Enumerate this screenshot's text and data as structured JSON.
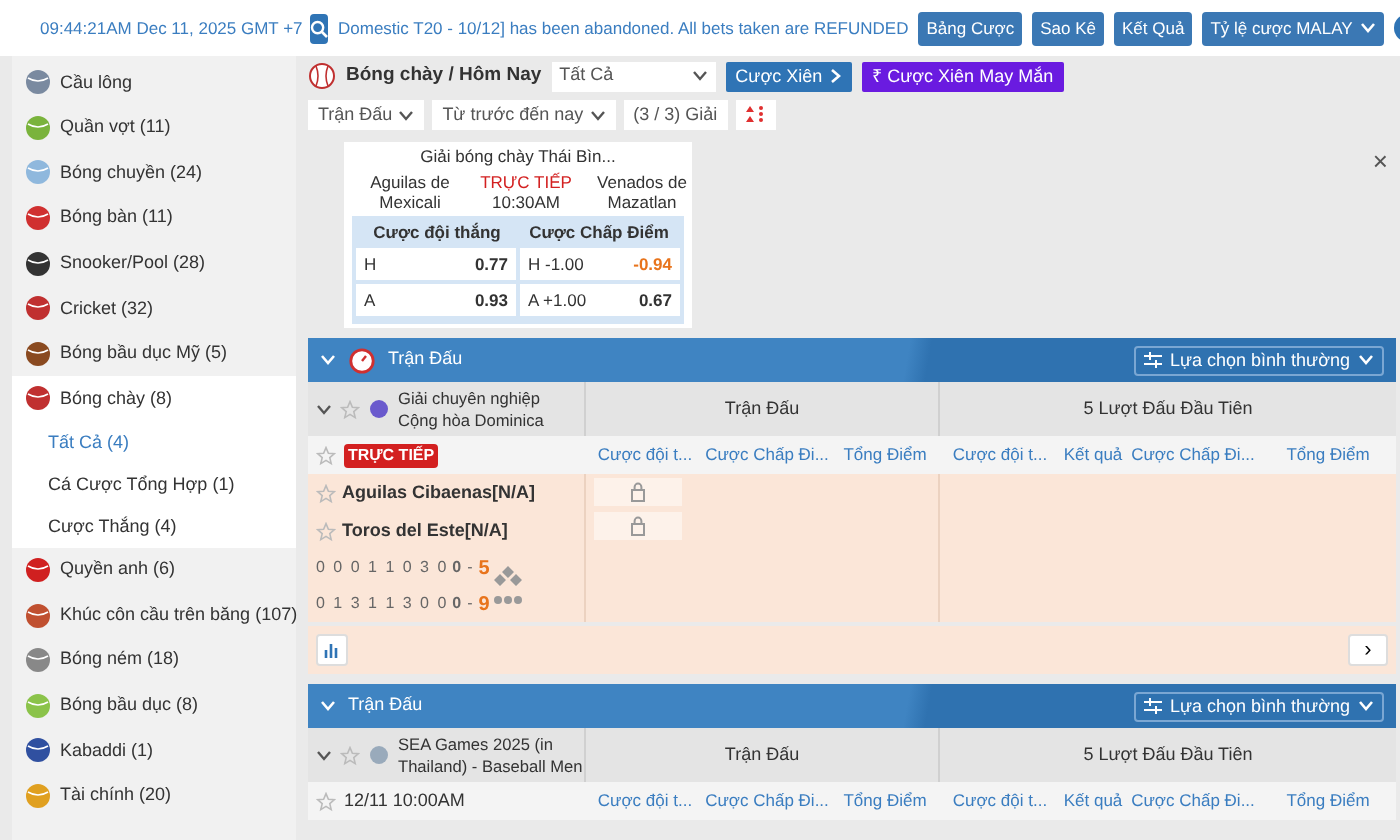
{
  "top_bar": {
    "clock": "09:44:21AM Dec 11, 2025 GMT +7",
    "announcement": "Domestic T20 - 10/12] has been abandoned. All bets taken are REFUNDED",
    "buttons": [
      "Bảng Cược",
      "Sao Kê",
      "Kết Quả"
    ],
    "odds_format": "Tỷ lệ cược MALAY",
    "toggle_on": true
  },
  "sidebar": {
    "items": [
      {
        "label": "Cầu lông",
        "selected": false
      },
      {
        "label": "Quần vợt (11)",
        "selected": false
      },
      {
        "label": "Bóng chuyền (24)",
        "selected": false
      },
      {
        "label": "Bóng bàn (11)",
        "selected": false
      },
      {
        "label": "Snooker/Pool (28)",
        "selected": false
      },
      {
        "label": "Cricket (32)",
        "selected": false
      },
      {
        "label": "Bóng bầu dục Mỹ (5)",
        "selected": false
      },
      {
        "label": "Bóng chày (8)",
        "selected": true,
        "children": [
          {
            "label": "Tất Cả (4)",
            "selected": true
          },
          {
            "label": "Cá Cược Tổng Hợp (1)",
            "selected": false
          },
          {
            "label": "Cược Thắng (4)",
            "selected": false
          }
        ]
      },
      {
        "label": "Quyền anh (6)",
        "selected": false
      },
      {
        "label": "Khúc côn cầu trên băng (107)",
        "selected": false
      },
      {
        "label": "Bóng ném (18)",
        "selected": false
      },
      {
        "label": "Bóng bầu dục (8)",
        "selected": false
      },
      {
        "label": "Kabaddi (1)",
        "selected": false
      },
      {
        "label": "Tài chính (20)",
        "selected": false
      }
    ]
  },
  "toolbar": {
    "breadcrumb": "Bóng chày / Hôm Nay",
    "market_select": "Tất Cả",
    "parlay_button": "Cược Xiên",
    "lucky_symbol": "₹",
    "lucky_button": "Cược Xiên May Mắn",
    "filter_type": "Trận Đấu",
    "filter_time": "Từ trước đến nay",
    "league_count": "(3 / 3) Giải"
  },
  "featured": {
    "league": "Giải bóng chày Thái Bìn...",
    "home": "Aguilas de Mexicali",
    "status": "TRỰC TIẾP",
    "time": "10:30AM",
    "away": "Venados de Mazatlan",
    "close": "×",
    "headers": [
      "Cược đội thắng",
      "Cược Chấp Điểm"
    ],
    "rows": [
      {
        "side": "H",
        "win": "0.77",
        "hcp_side": "H",
        "hcp": "-1.00",
        "hcp_odds": "-0.94",
        "negative": true
      },
      {
        "side": "A",
        "win": "0.93",
        "hcp_side": "A",
        "hcp": "+1.00",
        "hcp_odds": "0.67",
        "negative": false
      }
    ]
  },
  "sections": [
    {
      "title": "Trận Đấu",
      "clock_icon": true,
      "view": "Lựa chọn bình thường",
      "league": "Giải chuyên nghiệp Cộng hòa Dominica",
      "group_1": "Trận Đấu",
      "group_2": "5 Lượt Đấu Đầu Tiên",
      "status": "TRỰC TIẾP",
      "live": true,
      "columns": [
        "Cược đội t...",
        "Cược Chấp Đi...",
        "Tổng Điểm",
        "Cược đội t...",
        "Kết quả",
        "Cược Chấp Đi...",
        "Tổng Điểm"
      ],
      "teams": [
        "Aguilas Cibaenas[N/A]",
        "Toros del Este[N/A]"
      ],
      "score_lines": [
        {
          "innings": "0 0 0 1 1 0 3 0",
          "current": "0",
          "dash": "-",
          "total": "5"
        },
        {
          "innings": "0 1 3 1 1 3 0 0",
          "current": "0",
          "dash": "-",
          "total": "9"
        }
      ],
      "next": "›"
    },
    {
      "title": "Trận Đấu",
      "clock_icon": false,
      "view": "Lựa chọn bình thường",
      "league": "SEA Games 2025 (in Thailand) - Baseball Men",
      "group_1": "Trận Đấu",
      "group_2": "5 Lượt Đấu Đầu Tiên",
      "status": "12/11 10:00AM",
      "live": false,
      "columns": [
        "Cược đội t...",
        "Cược Chấp Đi...",
        "Tổng Điểm",
        "Cược đội t...",
        "Kết quả",
        "Cược Chấp Đi...",
        "Tổng Điểm"
      ]
    }
  ]
}
